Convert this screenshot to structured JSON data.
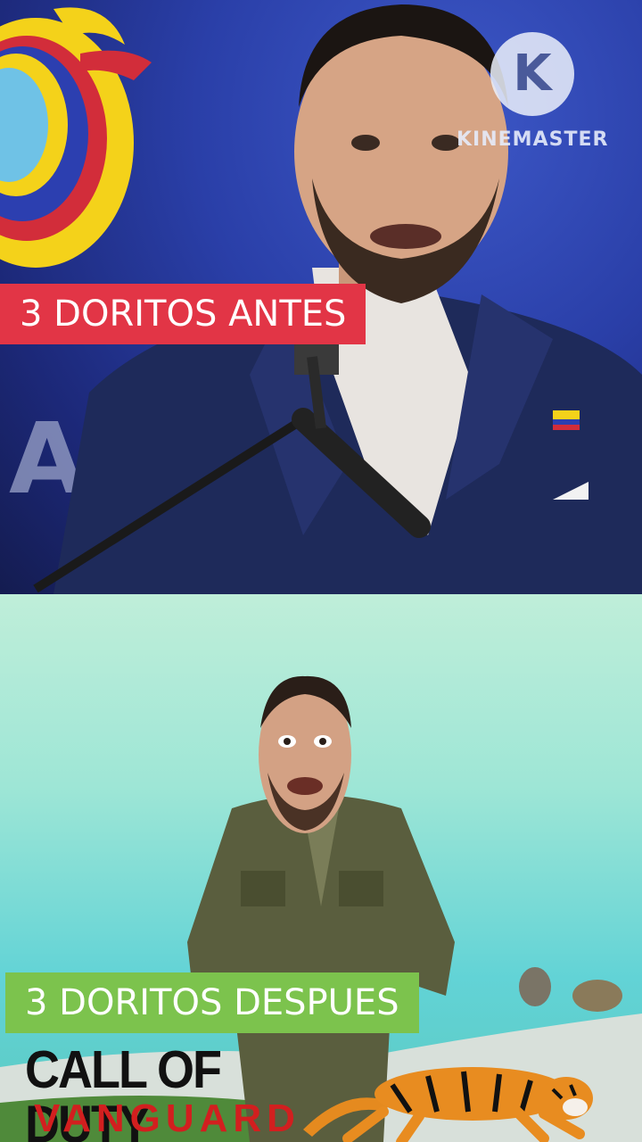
{
  "top_panel": {
    "caption": "3 DORITOS ANTES",
    "caption_color": "#e23546",
    "watermark": {
      "icon": "kinemaster-k-icon",
      "logo_letter": "K",
      "text": "KINEMASTER"
    },
    "background_letters": "AR"
  },
  "bottom_panel": {
    "caption": "3 DORITOS DESPUES",
    "caption_color": "#7cc34d",
    "game_logo": {
      "line1": "CALL OF DUTY",
      "line2": "VANGUARD"
    },
    "tiger_icon": "tiger-icon"
  }
}
